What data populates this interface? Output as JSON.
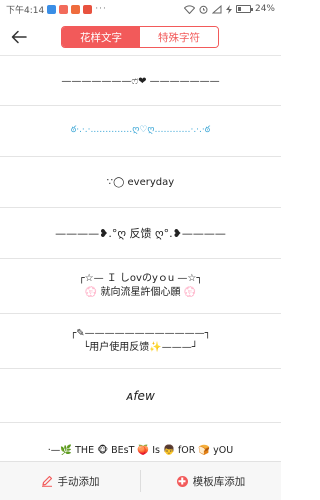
{
  "status_bar": {
    "time": "下午4:14",
    "battery": "24%",
    "battery_level": 0.24,
    "icons": [
      "shield-icon",
      "app-icon",
      "app-icon",
      "app-icon",
      "more-icon",
      "wifi-icon",
      "alarm-icon",
      "signal-icon",
      "charging-icon",
      "battery-icon"
    ]
  },
  "header": {
    "tabs": [
      {
        "label": "花样文字",
        "active": true
      },
      {
        "label": "特殊字符",
        "active": false
      }
    ],
    "accent": "#f25a5a"
  },
  "rows": [
    {
      "text": "———————ෆ̈❤ ———————"
    },
    {
      "text": "ఠ·.·.·..…………ღ♡ღ…………·.·.·ఠ"
    },
    {
      "text": "∵◯   everyday"
    },
    {
      "text": "————❥.°ღ 反馈 ღ°.❥————"
    },
    {
      "line1": "┌☆— Ｉ しovのyｏu —☆┐",
      "line2": "💮 就向流星許個心願 💮"
    },
    {
      "line1": "┌✎————————————┐",
      "line2": "└用户使用反馈✨———┘"
    },
    {
      "text": "ᴀfew"
    },
    {
      "text": "·—🌿 THE 🐵 BEsT 🍑 Is 👦 fOR 🍞 yOU"
    }
  ],
  "bottom_bar": {
    "manual_label": "手动添加",
    "template_label": "模板库添加"
  }
}
